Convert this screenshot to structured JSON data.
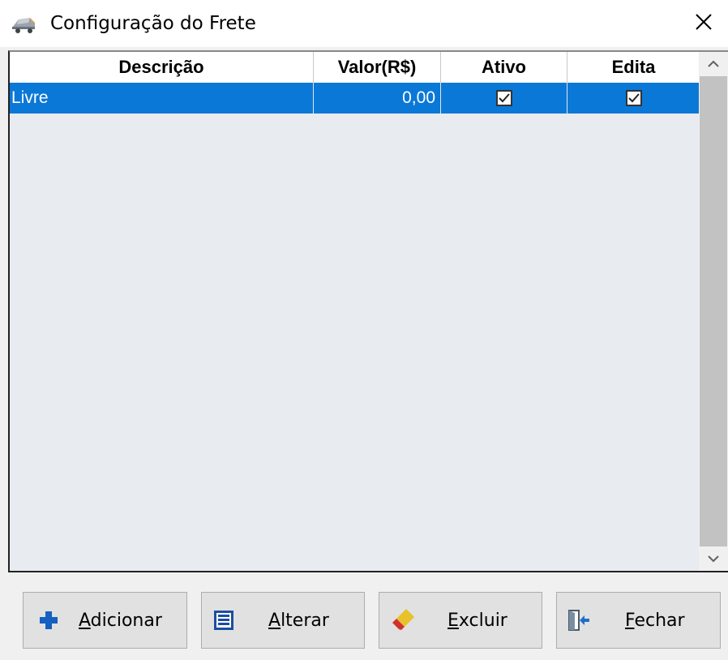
{
  "window": {
    "title": "Configuração do Frete",
    "icon": "truck-icon",
    "close_icon": "close-icon"
  },
  "grid": {
    "columns": [
      "Descrição",
      "Valor(R$)",
      "Ativo",
      "Edita"
    ],
    "rows": [
      {
        "descricao": "Livre",
        "valor": "0,00",
        "ativo": true,
        "edita": true,
        "selected": true
      }
    ],
    "selection_color": "#0a78d7",
    "background_color": "#e8ebef"
  },
  "buttons": {
    "add": {
      "accel": "A",
      "rest": "dicionar",
      "icon": "plus-icon",
      "color": "#1560c0"
    },
    "alter": {
      "accel": "A",
      "rest": "lterar",
      "icon": "list-icon",
      "color": "#1a4fa0"
    },
    "delete": {
      "accel": "E",
      "rest": "xcluir",
      "icon": "eraser-icon",
      "color": "#d0312d"
    },
    "close": {
      "accel": "F",
      "rest": "echar",
      "icon": "exit-door-icon",
      "color": "#1f6fc9"
    }
  }
}
